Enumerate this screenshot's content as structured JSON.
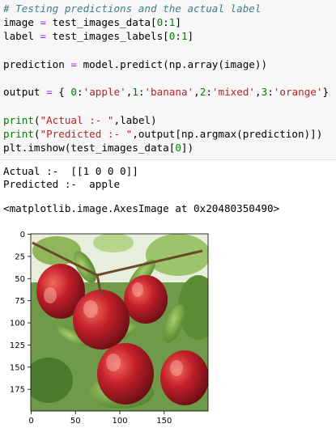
{
  "cell": {
    "lines": [
      {
        "parts": [
          {
            "t": "# Testing predictions and the actual label",
            "c": "c-com"
          }
        ]
      },
      {
        "parts": [
          {
            "t": "image "
          },
          {
            "t": "=",
            "c": "c-op"
          },
          {
            "t": " test_images_data["
          },
          {
            "t": "0",
            "c": "c-num"
          },
          {
            "t": ":"
          },
          {
            "t": "1",
            "c": "c-num"
          },
          {
            "t": "]"
          }
        ]
      },
      {
        "parts": [
          {
            "t": "label "
          },
          {
            "t": "=",
            "c": "c-op"
          },
          {
            "t": " test_images_labels["
          },
          {
            "t": "0",
            "c": "c-num"
          },
          {
            "t": ":"
          },
          {
            "t": "1",
            "c": "c-num"
          },
          {
            "t": "]"
          }
        ]
      },
      {
        "parts": [
          {
            "t": ""
          }
        ]
      },
      {
        "parts": [
          {
            "t": "prediction "
          },
          {
            "t": "=",
            "c": "c-op"
          },
          {
            "t": " model.predict(np.array(image))"
          }
        ]
      },
      {
        "parts": [
          {
            "t": ""
          }
        ]
      },
      {
        "parts": [
          {
            "t": "output "
          },
          {
            "t": "=",
            "c": "c-op"
          },
          {
            "t": " { "
          },
          {
            "t": "0",
            "c": "c-num"
          },
          {
            "t": ":"
          },
          {
            "t": "'apple'",
            "c": "c-str"
          },
          {
            "t": ","
          },
          {
            "t": "1",
            "c": "c-num"
          },
          {
            "t": ":"
          },
          {
            "t": "'banana'",
            "c": "c-str"
          },
          {
            "t": ","
          },
          {
            "t": "2",
            "c": "c-num"
          },
          {
            "t": ":"
          },
          {
            "t": "'mixed'",
            "c": "c-str"
          },
          {
            "t": ","
          },
          {
            "t": "3",
            "c": "c-num"
          },
          {
            "t": ":"
          },
          {
            "t": "'orange'",
            "c": "c-str"
          },
          {
            "t": "}"
          }
        ]
      },
      {
        "parts": [
          {
            "t": ""
          }
        ]
      },
      {
        "parts": [
          {
            "t": "print",
            "c": "c-kw"
          },
          {
            "t": "("
          },
          {
            "t": "\"Actual :- \"",
            "c": "c-str"
          },
          {
            "t": ",label)"
          }
        ]
      },
      {
        "parts": [
          {
            "t": "print",
            "c": "c-kw"
          },
          {
            "t": "("
          },
          {
            "t": "\"Predicted :- \"",
            "c": "c-str"
          },
          {
            "t": ",output[np.argmax(prediction)])"
          }
        ]
      },
      {
        "parts": [
          {
            "t": "plt.imshow(test_images_data["
          },
          {
            "t": "0",
            "c": "c-num"
          },
          {
            "t": "])"
          }
        ]
      }
    ]
  },
  "output": {
    "actual_line": "Actual :-  [[1 0 0 0]]",
    "predicted_line": "Predicted :-  apple",
    "repr_line": "<matplotlib.image.AxesImage at 0x20480350490>"
  },
  "plot": {
    "y_ticks": [
      "0",
      "25",
      "50",
      "75",
      "100",
      "125",
      "150",
      "175"
    ],
    "x_ticks": [
      "0",
      "50",
      "100",
      "150"
    ],
    "y_values": [
      0,
      25,
      50,
      75,
      100,
      125,
      150,
      175
    ],
    "x_values": [
      0,
      50,
      100,
      150
    ],
    "image_size": 200,
    "image_description_icon": "apples-photo-icon"
  }
}
